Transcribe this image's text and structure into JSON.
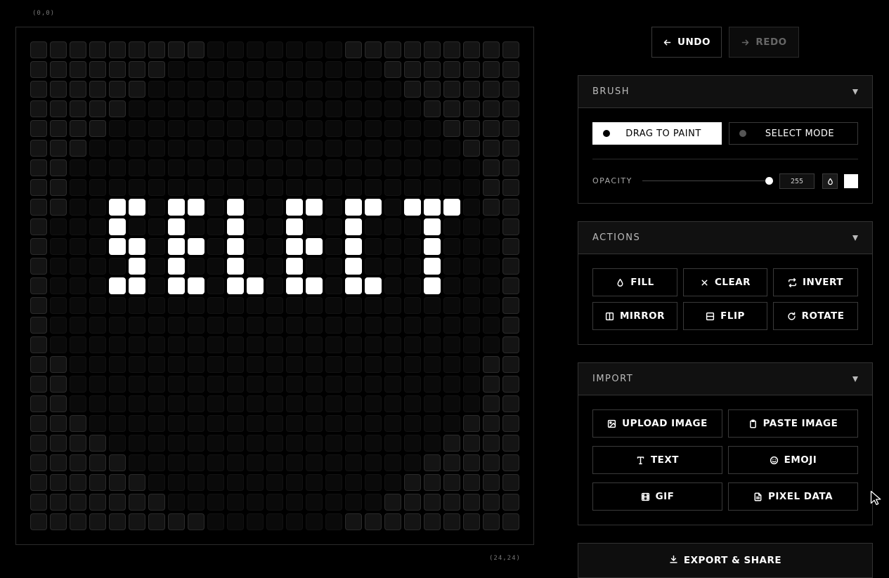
{
  "canvas": {
    "coord_top_left": "(0,0)",
    "coord_bottom_right": "(24,24)",
    "grid_size": 25,
    "lit_pixels": [
      [
        8,
        4
      ],
      [
        8,
        5
      ],
      [
        9,
        4
      ],
      [
        10,
        4
      ],
      [
        10,
        5
      ],
      [
        11,
        5
      ],
      [
        12,
        4
      ],
      [
        12,
        5
      ],
      [
        8,
        7
      ],
      [
        8,
        8
      ],
      [
        9,
        7
      ],
      [
        10,
        7
      ],
      [
        10,
        8
      ],
      [
        11,
        7
      ],
      [
        12,
        7
      ],
      [
        12,
        8
      ],
      [
        8,
        10
      ],
      [
        9,
        10
      ],
      [
        10,
        10
      ],
      [
        11,
        10
      ],
      [
        12,
        10
      ],
      [
        12,
        11
      ],
      [
        8,
        13
      ],
      [
        8,
        14
      ],
      [
        9,
        13
      ],
      [
        10,
        13
      ],
      [
        10,
        14
      ],
      [
        11,
        13
      ],
      [
        12,
        13
      ],
      [
        12,
        14
      ],
      [
        8,
        16
      ],
      [
        8,
        17
      ],
      [
        9,
        16
      ],
      [
        10,
        16
      ],
      [
        11,
        16
      ],
      [
        12,
        16
      ],
      [
        12,
        17
      ],
      [
        8,
        19
      ],
      [
        8,
        20
      ],
      [
        8,
        21
      ],
      [
        9,
        20
      ],
      [
        10,
        20
      ],
      [
        11,
        20
      ],
      [
        12,
        20
      ]
    ]
  },
  "history": {
    "undo_label": "UNDO",
    "redo_label": "REDO"
  },
  "brush": {
    "title": "BRUSH",
    "drag_label": "DRAG TO PAINT",
    "select_label": "SELECT MODE",
    "active_mode": "drag",
    "opacity_label": "OPACITY",
    "opacity_value": "255",
    "opacity_fraction": 1.0,
    "brush_color": "#ffffff"
  },
  "actions": {
    "title": "ACTIONS",
    "items": [
      {
        "label": "FILL",
        "icon": "droplet-icon"
      },
      {
        "label": "CLEAR",
        "icon": "x-icon"
      },
      {
        "label": "INVERT",
        "icon": "swap-icon"
      },
      {
        "label": "MIRROR",
        "icon": "columns-icon"
      },
      {
        "label": "FLIP",
        "icon": "rows-icon"
      },
      {
        "label": "ROTATE",
        "icon": "rotate-icon"
      }
    ]
  },
  "import": {
    "title": "IMPORT",
    "items": [
      {
        "label": "UPLOAD IMAGE",
        "icon": "image-icon"
      },
      {
        "label": "PASTE IMAGE",
        "icon": "clipboard-icon"
      },
      {
        "label": "TEXT",
        "icon": "type-icon"
      },
      {
        "label": "EMOJI",
        "icon": "smile-icon"
      },
      {
        "label": "GIF",
        "icon": "film-icon"
      },
      {
        "label": "PIXEL DATA",
        "icon": "file-icon"
      }
    ]
  },
  "export": {
    "label": "EXPORT & SHARE",
    "icon": "download-icon"
  }
}
